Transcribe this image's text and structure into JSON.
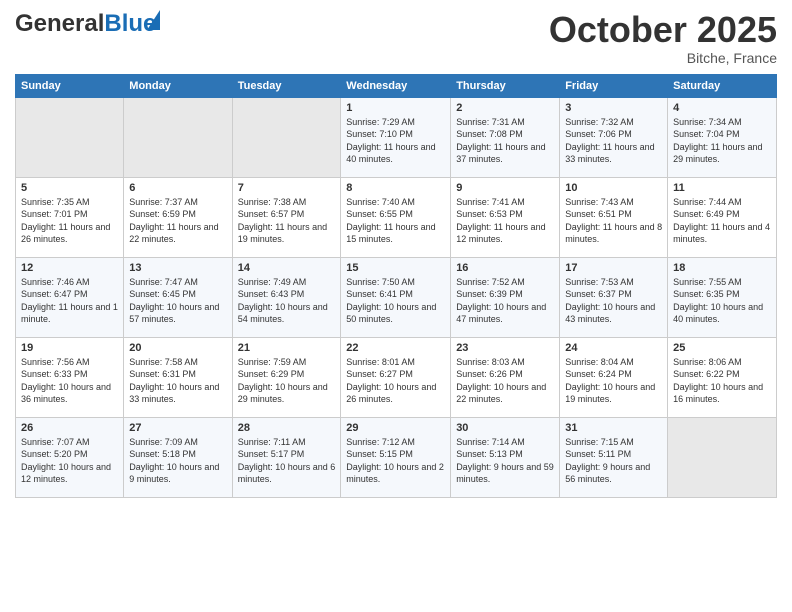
{
  "header": {
    "logo_general": "General",
    "logo_blue": "Blue",
    "month_title": "October 2025",
    "location": "Bitche, France"
  },
  "weekdays": [
    "Sunday",
    "Monday",
    "Tuesday",
    "Wednesday",
    "Thursday",
    "Friday",
    "Saturday"
  ],
  "weeks": [
    [
      {
        "day": "",
        "sunrise": "",
        "sunset": "",
        "daylight": ""
      },
      {
        "day": "",
        "sunrise": "",
        "sunset": "",
        "daylight": ""
      },
      {
        "day": "",
        "sunrise": "",
        "sunset": "",
        "daylight": ""
      },
      {
        "day": "1",
        "sunrise": "Sunrise: 7:29 AM",
        "sunset": "Sunset: 7:10 PM",
        "daylight": "Daylight: 11 hours and 40 minutes."
      },
      {
        "day": "2",
        "sunrise": "Sunrise: 7:31 AM",
        "sunset": "Sunset: 7:08 PM",
        "daylight": "Daylight: 11 hours and 37 minutes."
      },
      {
        "day": "3",
        "sunrise": "Sunrise: 7:32 AM",
        "sunset": "Sunset: 7:06 PM",
        "daylight": "Daylight: 11 hours and 33 minutes."
      },
      {
        "day": "4",
        "sunrise": "Sunrise: 7:34 AM",
        "sunset": "Sunset: 7:04 PM",
        "daylight": "Daylight: 11 hours and 29 minutes."
      }
    ],
    [
      {
        "day": "5",
        "sunrise": "Sunrise: 7:35 AM",
        "sunset": "Sunset: 7:01 PM",
        "daylight": "Daylight: 11 hours and 26 minutes."
      },
      {
        "day": "6",
        "sunrise": "Sunrise: 7:37 AM",
        "sunset": "Sunset: 6:59 PM",
        "daylight": "Daylight: 11 hours and 22 minutes."
      },
      {
        "day": "7",
        "sunrise": "Sunrise: 7:38 AM",
        "sunset": "Sunset: 6:57 PM",
        "daylight": "Daylight: 11 hours and 19 minutes."
      },
      {
        "day": "8",
        "sunrise": "Sunrise: 7:40 AM",
        "sunset": "Sunset: 6:55 PM",
        "daylight": "Daylight: 11 hours and 15 minutes."
      },
      {
        "day": "9",
        "sunrise": "Sunrise: 7:41 AM",
        "sunset": "Sunset: 6:53 PM",
        "daylight": "Daylight: 11 hours and 12 minutes."
      },
      {
        "day": "10",
        "sunrise": "Sunrise: 7:43 AM",
        "sunset": "Sunset: 6:51 PM",
        "daylight": "Daylight: 11 hours and 8 minutes."
      },
      {
        "day": "11",
        "sunrise": "Sunrise: 7:44 AM",
        "sunset": "Sunset: 6:49 PM",
        "daylight": "Daylight: 11 hours and 4 minutes."
      }
    ],
    [
      {
        "day": "12",
        "sunrise": "Sunrise: 7:46 AM",
        "sunset": "Sunset: 6:47 PM",
        "daylight": "Daylight: 11 hours and 1 minute."
      },
      {
        "day": "13",
        "sunrise": "Sunrise: 7:47 AM",
        "sunset": "Sunset: 6:45 PM",
        "daylight": "Daylight: 10 hours and 57 minutes."
      },
      {
        "day": "14",
        "sunrise": "Sunrise: 7:49 AM",
        "sunset": "Sunset: 6:43 PM",
        "daylight": "Daylight: 10 hours and 54 minutes."
      },
      {
        "day": "15",
        "sunrise": "Sunrise: 7:50 AM",
        "sunset": "Sunset: 6:41 PM",
        "daylight": "Daylight: 10 hours and 50 minutes."
      },
      {
        "day": "16",
        "sunrise": "Sunrise: 7:52 AM",
        "sunset": "Sunset: 6:39 PM",
        "daylight": "Daylight: 10 hours and 47 minutes."
      },
      {
        "day": "17",
        "sunrise": "Sunrise: 7:53 AM",
        "sunset": "Sunset: 6:37 PM",
        "daylight": "Daylight: 10 hours and 43 minutes."
      },
      {
        "day": "18",
        "sunrise": "Sunrise: 7:55 AM",
        "sunset": "Sunset: 6:35 PM",
        "daylight": "Daylight: 10 hours and 40 minutes."
      }
    ],
    [
      {
        "day": "19",
        "sunrise": "Sunrise: 7:56 AM",
        "sunset": "Sunset: 6:33 PM",
        "daylight": "Daylight: 10 hours and 36 minutes."
      },
      {
        "day": "20",
        "sunrise": "Sunrise: 7:58 AM",
        "sunset": "Sunset: 6:31 PM",
        "daylight": "Daylight: 10 hours and 33 minutes."
      },
      {
        "day": "21",
        "sunrise": "Sunrise: 7:59 AM",
        "sunset": "Sunset: 6:29 PM",
        "daylight": "Daylight: 10 hours and 29 minutes."
      },
      {
        "day": "22",
        "sunrise": "Sunrise: 8:01 AM",
        "sunset": "Sunset: 6:27 PM",
        "daylight": "Daylight: 10 hours and 26 minutes."
      },
      {
        "day": "23",
        "sunrise": "Sunrise: 8:03 AM",
        "sunset": "Sunset: 6:26 PM",
        "daylight": "Daylight: 10 hours and 22 minutes."
      },
      {
        "day": "24",
        "sunrise": "Sunrise: 8:04 AM",
        "sunset": "Sunset: 6:24 PM",
        "daylight": "Daylight: 10 hours and 19 minutes."
      },
      {
        "day": "25",
        "sunrise": "Sunrise: 8:06 AM",
        "sunset": "Sunset: 6:22 PM",
        "daylight": "Daylight: 10 hours and 16 minutes."
      }
    ],
    [
      {
        "day": "26",
        "sunrise": "Sunrise: 7:07 AM",
        "sunset": "Sunset: 5:20 PM",
        "daylight": "Daylight: 10 hours and 12 minutes."
      },
      {
        "day": "27",
        "sunrise": "Sunrise: 7:09 AM",
        "sunset": "Sunset: 5:18 PM",
        "daylight": "Daylight: 10 hours and 9 minutes."
      },
      {
        "day": "28",
        "sunrise": "Sunrise: 7:11 AM",
        "sunset": "Sunset: 5:17 PM",
        "daylight": "Daylight: 10 hours and 6 minutes."
      },
      {
        "day": "29",
        "sunrise": "Sunrise: 7:12 AM",
        "sunset": "Sunset: 5:15 PM",
        "daylight": "Daylight: 10 hours and 2 minutes."
      },
      {
        "day": "30",
        "sunrise": "Sunrise: 7:14 AM",
        "sunset": "Sunset: 5:13 PM",
        "daylight": "Daylight: 9 hours and 59 minutes."
      },
      {
        "day": "31",
        "sunrise": "Sunrise: 7:15 AM",
        "sunset": "Sunset: 5:11 PM",
        "daylight": "Daylight: 9 hours and 56 minutes."
      },
      {
        "day": "",
        "sunrise": "",
        "sunset": "",
        "daylight": ""
      }
    ]
  ]
}
